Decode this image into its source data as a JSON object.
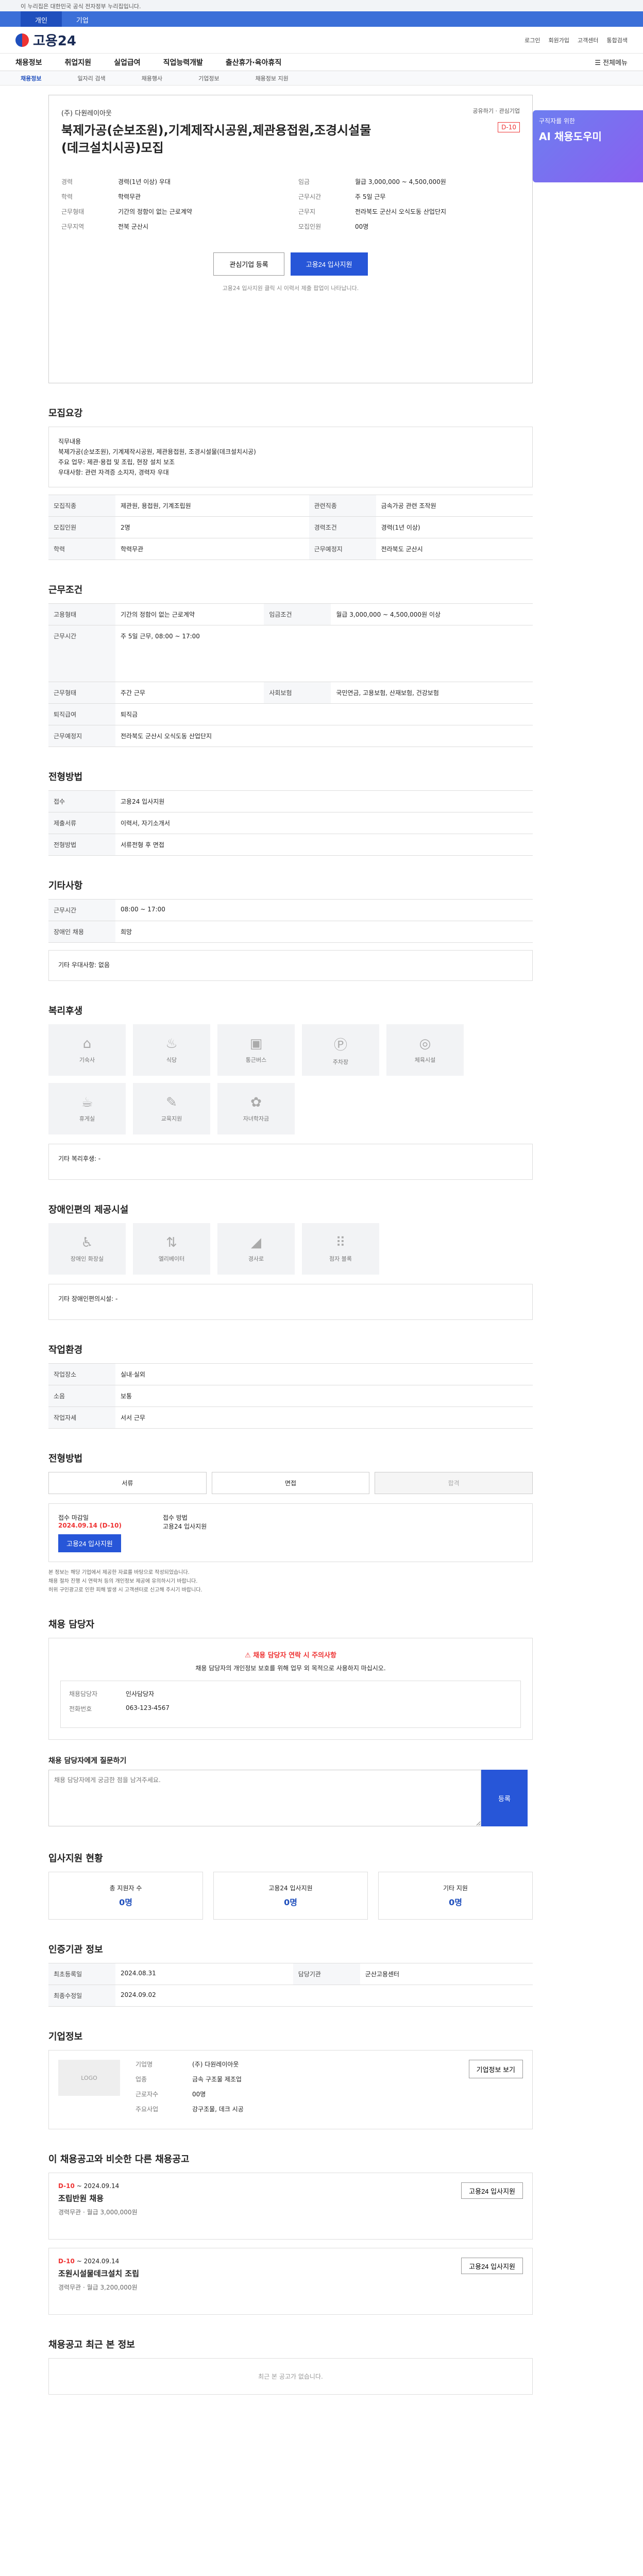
{
  "gov_banner": "이 누리집은 대한민국 공식 전자정부 누리집입니다.",
  "top_tabs": [
    "개인",
    "기업"
  ],
  "logo_text": "고용24",
  "util_links": [
    "로그인",
    "회원가입",
    "고객센터",
    "통합검색"
  ],
  "gnb": [
    "채용정보",
    "취업지원",
    "실업급여",
    "직업능력개발",
    "출산휴가·육아휴직"
  ],
  "gnb_right": "전체메뉴",
  "subnav": [
    "채용정보",
    "일자리 검색",
    "채용행사",
    "기업정보",
    "채용정보 지원"
  ],
  "job": {
    "company": "(주) 다원레이아웃",
    "title": "북제가공(순보조원),기계제작시공원,제관용접원,조경시설물(데크설치시공)모집",
    "dday": "D-10",
    "share": "공유하기 · 관심기업",
    "left": [
      {
        "k": "경력",
        "v": "경력(1년 이상) 우대"
      },
      {
        "k": "학력",
        "v": "학력무관"
      },
      {
        "k": "근무형태",
        "v": "기간의 정함이 없는 근로계약"
      },
      {
        "k": "근무지역",
        "v": "전북 군산시"
      }
    ],
    "right": [
      {
        "k": "임금",
        "v": "월급 3,000,000 ~ 4,500,000원"
      },
      {
        "k": "근무시간",
        "v": "주 5일 근무"
      },
      {
        "k": "근무지",
        "v": "전라북도 군산시 오식도동 산업단지"
      },
      {
        "k": "모집인원",
        "v": "00명"
      }
    ],
    "btn_interest": "관심기업 등록",
    "btn_apply": "고용24 입사지원",
    "note": "고용24 입사지원 클릭 시 이력서 제출 팝업이 나타납니다."
  },
  "side_banner": {
    "small": "구직자를 위한",
    "big": "AI 채용도우미"
  },
  "sec_detail": {
    "title": "모집요강",
    "body": "직무내용\n북제가공(순보조원), 기계제작시공원, 제관용접원, 조경시설물(데크설치시공)\n주요 업무: 제관·용접 및 조립, 현장 설치 보조\n우대사항: 관련 자격증 소지자, 경력자 우대",
    "rows": [
      {
        "k": "모집직종",
        "v": "제관원, 용접원, 기계조립원"
      },
      {
        "k": "관련직종",
        "v": "금속가공 관련 조작원"
      },
      {
        "k": "모집인원",
        "v": "2명"
      },
      {
        "k": "경력조건",
        "v": "경력(1년 이상)"
      },
      {
        "k": "학력",
        "v": "학력무관"
      },
      {
        "k": "근무예정지",
        "v": "전라북도 군산시"
      }
    ]
  },
  "sec_condition": {
    "title": "근무조건",
    "rows": [
      {
        "k": "고용형태",
        "v": "기간의 정함이 없는 근로계약"
      },
      {
        "k": "임금조건",
        "v": "월급 3,000,000 ~ 4,500,000원 이상"
      },
      {
        "k": "근무시간",
        "v": "주 5일 근무, 08:00 ~ 17:00"
      },
      {
        "k": "근무형태",
        "v": "주간 근무"
      },
      {
        "k": "사회보험",
        "v": "국민연금, 고용보험, 산재보험, 건강보험"
      },
      {
        "k": "퇴직급여",
        "v": "퇴직금"
      },
      {
        "k": "근무예정지",
        "v": "전라북도 군산시 오식도동 산업단지"
      }
    ]
  },
  "sec_method": {
    "title": "전형방법",
    "rows": [
      {
        "k": "접수",
        "v": "고용24 입사지원"
      },
      {
        "k": "제출서류",
        "v": "이력서, 자기소개서"
      },
      {
        "k": "전형방법",
        "v": "서류전형 후 면접"
      }
    ]
  },
  "sec_other": {
    "title": "기타사항",
    "rows": [
      {
        "k": "근무시간",
        "v": "08:00 ~ 17:00"
      },
      {
        "k": "장애인 채용",
        "v": "희망"
      }
    ],
    "extra": "기타 우대사항: 없음"
  },
  "sec_welfare": {
    "title": "복리후생",
    "tiles": [
      "기숙사",
      "식당",
      "통근버스",
      "주차장",
      "체육시설",
      "휴게실",
      "교육지원",
      "자녀학자금"
    ],
    "note": "기타 복리후생: -"
  },
  "sec_disability": {
    "title": "장애인편의 제공시설",
    "tiles": [
      "장애인 화장실",
      "엘리베이터",
      "경사로",
      "점자 블록"
    ],
    "note": "기타 장애인편의시설: -"
  },
  "sec_env": {
    "title": "작업환경",
    "rows": [
      {
        "k": "작업장소",
        "v": "실내·실외"
      },
      {
        "k": "소음",
        "v": "보통"
      },
      {
        "k": "작업자세",
        "v": "서서 근무"
      }
    ]
  },
  "sec_process": {
    "title": "전형방법",
    "steps": [
      "서류",
      "면접",
      "합격"
    ],
    "deadline_label": "접수 마감일",
    "deadline": "2024.09.14 (D-10)",
    "apply_label": "접수 방법",
    "apply_v": "고용24 입사지원",
    "notes": [
      "본 정보는 해당 기업에서 제공한 자료를 바탕으로 작성되었습니다.",
      "채용 절차 진행 시 연락처 등의 개인정보 제공에 유의하시기 바랍니다.",
      "허위 구인광고로 인한 피해 발생 시 고객센터로 신고해 주시기 바랍니다."
    ]
  },
  "sec_contact": {
    "title": "채용 담당자",
    "warn": "채용 담당자 연락 시 주의사항",
    "desc": "채용 담당자의 개인정보 보호를 위해 업무 외 목적으로 사용하지 마십시오.",
    "name_label": "채용담당자",
    "name": "인사담당자",
    "phone_label": "전화번호",
    "phone": "063-123-4567"
  },
  "sec_inquiry": {
    "title": "채용 담당자에게 질문하기",
    "placeholder": "채용 담당자에게 궁금한 점을 남겨주세요.",
    "btn": "등록"
  },
  "sec_stats": {
    "title": "입사지원 현황",
    "cards": [
      {
        "label": "총 지원자 수",
        "n": "0명"
      },
      {
        "label": "고용24 입사지원",
        "n": "0명"
      },
      {
        "label": "기타 지원",
        "n": "0명"
      }
    ]
  },
  "sec_agency": {
    "title": "인증기관 정보",
    "rows": [
      {
        "k": "최초등록일",
        "v": "2024.08.31"
      },
      {
        "k": "최종수정일",
        "v": "2024.09.02"
      },
      {
        "k": "담당기관",
        "v": "군산고용센터"
      }
    ]
  },
  "sec_biz": {
    "title": "기업정보",
    "logo": "LOGO",
    "rows": [
      {
        "k": "기업명",
        "v": "(주) 다원레이아웃"
      },
      {
        "k": "업종",
        "v": "금속 구조물 제조업"
      },
      {
        "k": "근로자수",
        "v": "00명"
      },
      {
        "k": "주요사업",
        "v": "강구조물, 데크 시공"
      }
    ],
    "btn": "기업정보 보기"
  },
  "sec_recommend": {
    "title": "이 채용공고와 비슷한 다른 채용공고",
    "items": [
      {
        "tag": "D-10",
        "date": "~ 2024.09.14",
        "title": "조립반원 채용",
        "meta": "경력무관 · 월급 3,000,000원"
      },
      {
        "tag": "D-10",
        "date": "~ 2024.09.14",
        "title": "조원시설물데크설치 조립",
        "meta": "경력무관 · 월급 3,200,000원"
      }
    ]
  },
  "sec_recent": {
    "title": "채용공고 최근 본 정보",
    "empty": "최근 본 공고가 없습니다."
  }
}
